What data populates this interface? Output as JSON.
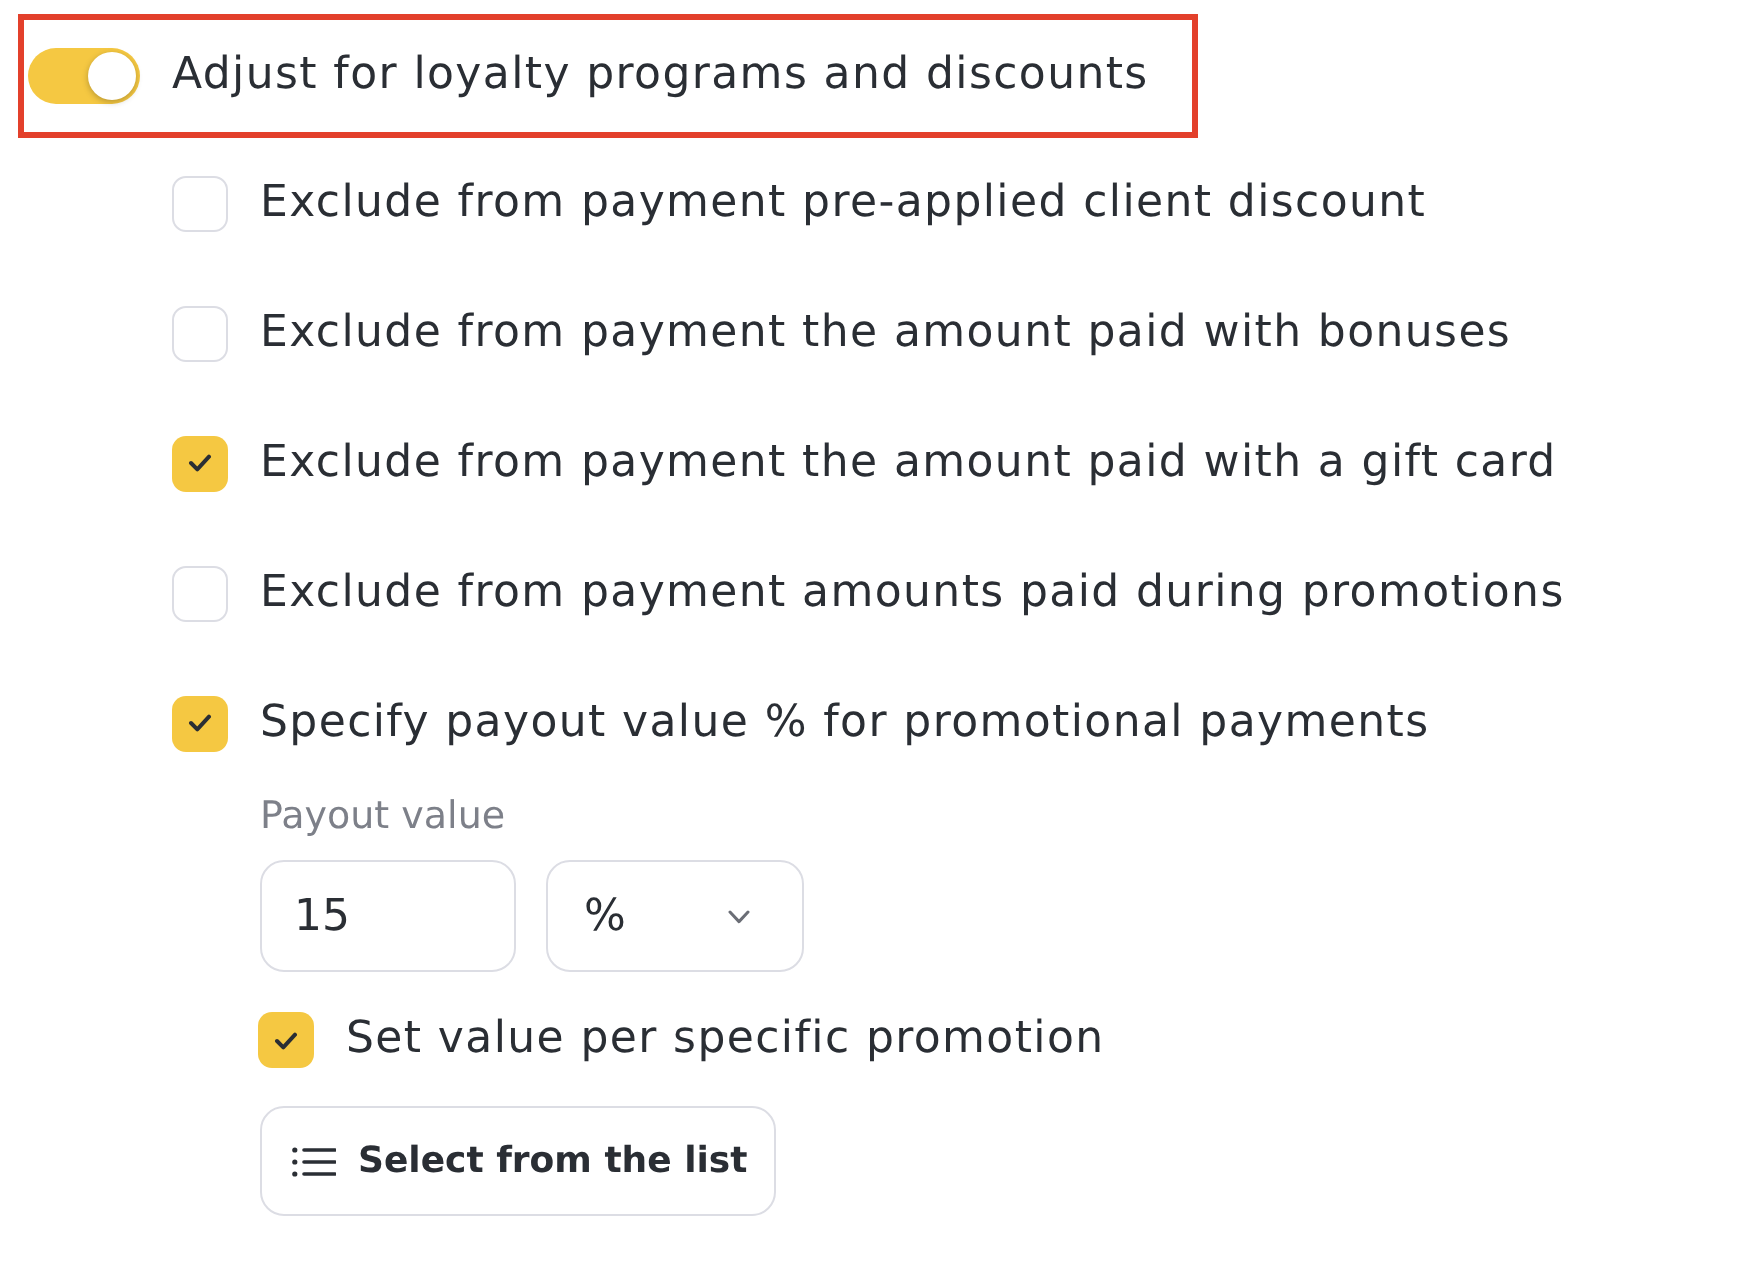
{
  "master_toggle": {
    "label": "Adjust for loyalty programs and discounts",
    "on": true,
    "highlighted": true
  },
  "options": [
    {
      "label": "Exclude from payment pre-applied client discount",
      "checked": false
    },
    {
      "label": "Exclude from payment the amount paid with bonuses",
      "checked": false
    },
    {
      "label": "Exclude from payment the amount paid with a gift card",
      "checked": true
    },
    {
      "label": "Exclude from payment amounts paid during promotions",
      "checked": false
    },
    {
      "label": "Specify payout value % for promotional payments",
      "checked": true
    }
  ],
  "payout": {
    "label": "Payout value",
    "value": "15",
    "unit": "%"
  },
  "per_promotion": {
    "label": "Set value per specific promotion",
    "checked": true
  },
  "select_button": {
    "label": "Select from the list"
  }
}
